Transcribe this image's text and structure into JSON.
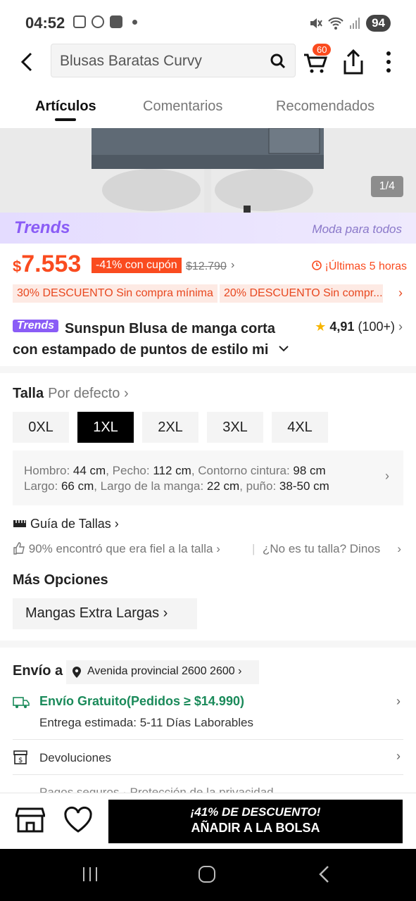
{
  "status_bar": {
    "time": "04:52",
    "battery": "94"
  },
  "search": {
    "value": "Blusas Baratas Curvy"
  },
  "cart": {
    "badge": "60"
  },
  "tabs": [
    "Artículos",
    "Comentarios",
    "Recomendados"
  ],
  "gallery": {
    "counter": "1/4"
  },
  "trends": {
    "logo": "Trends",
    "slogan": "Moda para todos"
  },
  "price": {
    "currency": "$",
    "amount": "7.553",
    "discount": "-41% con cupón",
    "original": "$12.790",
    "timer": "¡Últimas 5 horas"
  },
  "coupons": [
    "30% DESCUENTO Sin compra mínima",
    "20% DESCUENTO Sin compr..."
  ],
  "product": {
    "tag": "Trends",
    "title": "Sunspun Blusa de manga corta con estampado de puntos de estilo mi",
    "rating": "4,91",
    "reviews": "(100+)"
  },
  "size": {
    "label": "Talla",
    "default": "Por defecto",
    "options": [
      "0XL",
      "1XL",
      "2XL",
      "3XL",
      "4XL"
    ],
    "selected": "1XL",
    "measurements": {
      "hombro_label": "Hombro: ",
      "hombro": "44 cm",
      "pecho_label": ", Pecho: ",
      "pecho": "112 cm",
      "cintura_label": ", Contorno cintura: ",
      "cintura": "98 cm",
      "largo_label": "Largo: ",
      "largo": "66 cm",
      "manga_label": ", Largo de la manga: ",
      "manga": "22 cm",
      "puno_label": ", puño: ",
      "puno": "38-50 cm"
    },
    "guide": "Guía de Tallas",
    "fit": "90% encontró que era fiel a la talla",
    "not_your_size": "¿No es tu talla? Dinos"
  },
  "more_options": {
    "title": "Más Opciones",
    "chip": "Mangas Extra Largas"
  },
  "shipping": {
    "label": "Envío a",
    "address": "Avenida provincial 2600 2600",
    "free": "Envío Gratuito(Pedidos ≥ $14.990)",
    "estimate": "Entrega estimada: 5-11 Días Laborables",
    "returns": "Devoluciones",
    "secure": "Pagos seguros · Protección de la privacidad"
  },
  "cta": {
    "line1": "¡41% DE DESCUENTO!",
    "line2": "AÑADIR A LA BOLSA"
  },
  "colors": {
    "accent": "#fa4b1f",
    "trends": "#8a5cf6",
    "free_shipping": "#1a8a5a"
  }
}
